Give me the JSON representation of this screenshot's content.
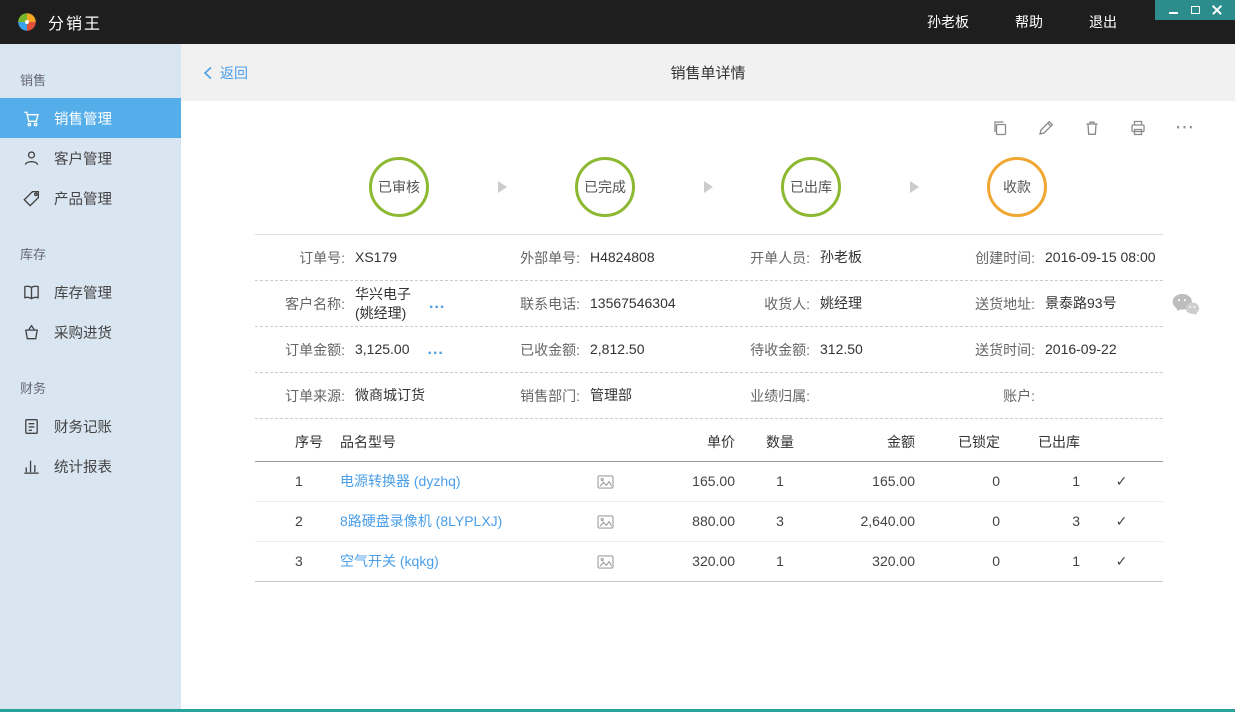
{
  "window": {
    "app_title": "分销王"
  },
  "topbar": {
    "user": "孙老板",
    "help": "帮助",
    "logout": "退出"
  },
  "sidebar": {
    "sections": [
      {
        "title": "销售",
        "items": [
          {
            "label": "销售管理"
          },
          {
            "label": "客户管理"
          },
          {
            "label": "产品管理"
          }
        ]
      },
      {
        "title": "库存",
        "items": [
          {
            "label": "库存管理"
          },
          {
            "label": "采购进货"
          }
        ]
      },
      {
        "title": "财务",
        "items": [
          {
            "label": "财务记账"
          },
          {
            "label": "统计报表"
          }
        ]
      }
    ]
  },
  "header": {
    "back_label": "返回",
    "title": "销售单详情"
  },
  "icons": {
    "more": "⋯",
    "check": "✓"
  },
  "steps": {
    "items": [
      {
        "label": "已审核"
      },
      {
        "label": "已完成"
      },
      {
        "label": "已出库"
      },
      {
        "label": "收款"
      }
    ]
  },
  "details": {
    "rows": [
      {
        "cells": [
          {
            "label": "订单号:",
            "value": "XS179"
          },
          {
            "label": "外部单号:",
            "value": "H4824808"
          },
          {
            "label": "开单人员:",
            "value": "孙老板"
          },
          {
            "label": "创建时间:",
            "value": "2016-09-15 08:00"
          }
        ]
      },
      {
        "cells": [
          {
            "label": "客户名称:",
            "value": "华兴电子\n(姚经理)",
            "more": "..."
          },
          {
            "label": "联系电话:",
            "value": "13567546304"
          },
          {
            "label": "收货人:",
            "value": "姚经理"
          },
          {
            "label": "送货地址:",
            "value": "景泰路93号"
          }
        ]
      },
      {
        "cells": [
          {
            "label": "订单金额:",
            "value": "3,125.00",
            "more": "..."
          },
          {
            "label": "已收金额:",
            "value": "2,812.50"
          },
          {
            "label": "待收金额:",
            "value": "312.50"
          },
          {
            "label": "送货时间:",
            "value": "2016-09-22"
          }
        ]
      },
      {
        "cells": [
          {
            "label": "订单来源:",
            "value": "微商城订货"
          },
          {
            "label": "销售部门:",
            "value": "管理部"
          },
          {
            "label": "业绩归属:",
            "value": ""
          },
          {
            "label": "账户:",
            "value": ""
          }
        ]
      }
    ]
  },
  "table": {
    "headers": {
      "no": "序号",
      "name": "品名型号",
      "price": "单价",
      "qty": "数量",
      "amount": "金额",
      "locked": "已锁定",
      "shipped": "已出库"
    },
    "rows": [
      {
        "no": "1",
        "name": "电源转换器 (dyzhq)",
        "price": "165.00",
        "qty": "1",
        "amount": "165.00",
        "locked": "0",
        "shipped": "1"
      },
      {
        "no": "2",
        "name": "8路硬盘录像机 (8LYPLXJ)",
        "price": "880.00",
        "qty": "3",
        "amount": "2,640.00",
        "locked": "0",
        "shipped": "3"
      },
      {
        "no": "3",
        "name": "空气开关 (kqkg)",
        "price": "320.00",
        "qty": "1",
        "amount": "320.00",
        "locked": "0",
        "shipped": "1"
      }
    ]
  },
  "colors": {
    "accent_blue": "#4a9ee8",
    "step_green": "#8cb832",
    "step_orange": "#f0a732",
    "sidebar_active": "#55ade9",
    "titlebar_teal": "#2d8c8c"
  }
}
